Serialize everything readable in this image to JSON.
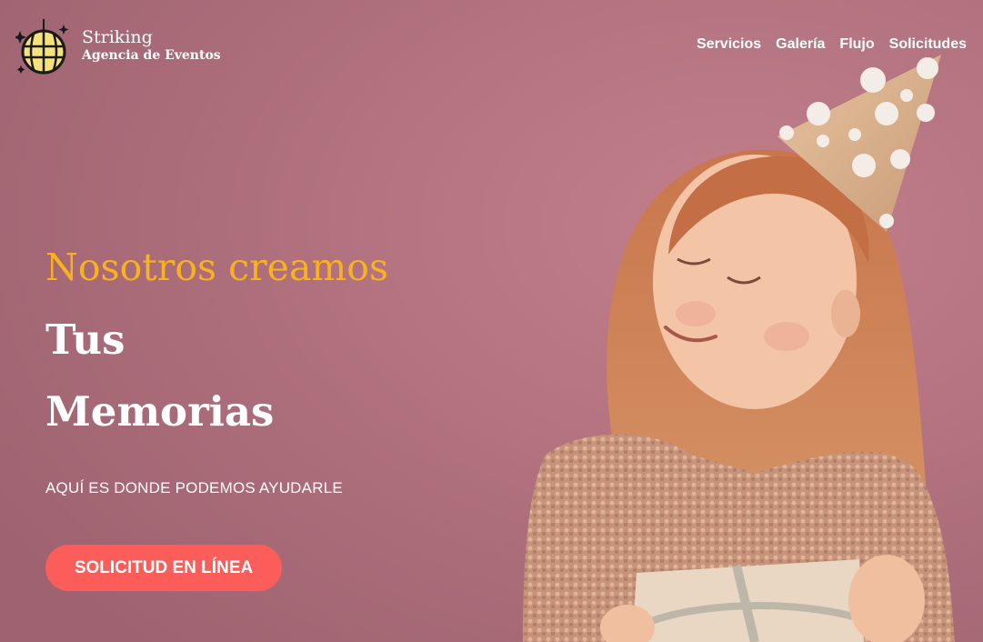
{
  "brand": {
    "name": "Striking",
    "subtitle": "Agencia de Eventos",
    "logo_icon": "disco-ball-icon"
  },
  "nav": {
    "items": [
      {
        "label": "Servicios"
      },
      {
        "label": "Galería"
      },
      {
        "label": "Flujo"
      },
      {
        "label": "Solicitudes"
      }
    ]
  },
  "hero": {
    "headline_1": "Nosotros creamos",
    "headline_2": "Tus",
    "headline_3": "Memorias",
    "tagline": "AQUÍ ES DONDE PODEMOS AYUDARLE",
    "cta_label": "SOLICITUD EN LÍNEA",
    "image": "girl-with-party-hat-photo"
  },
  "colors": {
    "background": "#a86a76",
    "accent_yellow": "#f9b21d",
    "cta": "#fb5d5b",
    "text": "#ffffff"
  }
}
